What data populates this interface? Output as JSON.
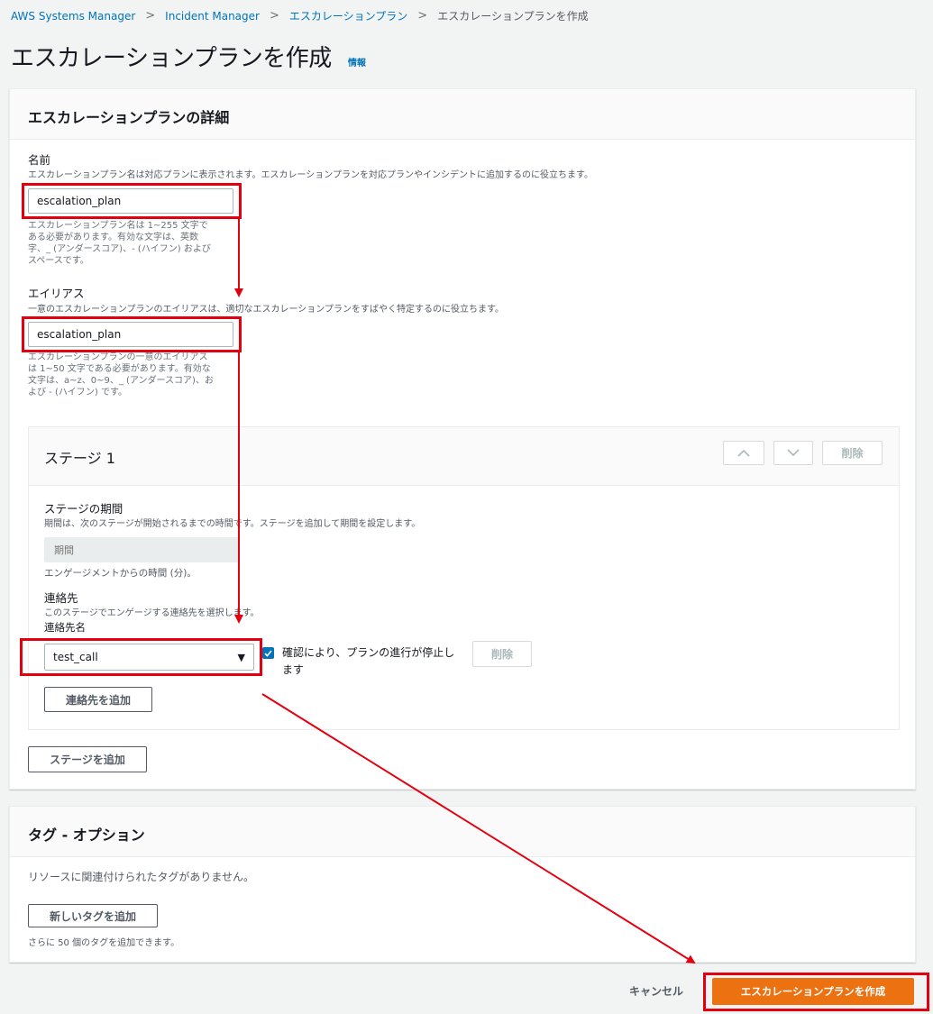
{
  "breadcrumb": {
    "items": [
      "AWS Systems Manager",
      "Incident Manager",
      "エスカレーションプラン"
    ],
    "current": "エスカレーションプランを作成"
  },
  "page": {
    "title": "エスカレーションプランを作成",
    "info": "情報"
  },
  "details": {
    "title": "エスカレーションプランの詳細",
    "name": {
      "label": "名前",
      "desc": "エスカレーションプラン名は対応プランに表示されます。エスカレーションプランを対応プランやインシデントに追加するのに役立ちます。",
      "value": "escalation_plan",
      "constraint": [
        "エスカレーションプラン名は 1~255 文字で",
        "ある必要があります。有効な文字は、英数",
        "字、_ (アンダースコア)、- (ハイフン) および",
        "スペースです。"
      ]
    },
    "alias": {
      "label": "エイリアス",
      "desc": "一意のエスカレーションプランのエイリアスは、適切なエスカレーションプランをすばやく特定するのに役立ちます。",
      "value": "escalation_plan",
      "constraint": [
        "エスカレーションプランの一意のエイリアス",
        "は 1~50 文字である必要があります。有効な",
        "文字は、a~z、0~9、_ (アンダースコア)、お",
        "よび - (ハイフン) です。"
      ]
    }
  },
  "stage": {
    "title": "ステージ 1",
    "up_icon": "chevron-up-icon",
    "down_icon": "chevron-down-icon",
    "delete_label": "削除",
    "duration": {
      "label": "ステージの期間",
      "desc": "期間は、次のステージが開始されるまでの時間です。ステージを追加して期間を設定します。",
      "placeholder": "期間",
      "hint": "エンゲージメントからの時間 (分)。"
    },
    "contacts": {
      "label": "連絡先",
      "desc": "このステージでエンゲージする連絡先を選択します。",
      "name_label": "連絡先名",
      "selected": "test_call",
      "ack_label_line1": "確認により、プランの進行が停止し",
      "ack_label_line2": "ます",
      "ack_checked": true,
      "delete_label": "削除",
      "add_label": "連絡先を追加"
    },
    "add_stage_label": "ステージを追加"
  },
  "tags": {
    "title": "タグ - オプション",
    "empty": "リソースに関連付けられたタグがありません。",
    "add_label": "新しいタグを追加",
    "hint": "さらに 50 個のタグを追加できます。"
  },
  "footer": {
    "cancel": "キャンセル",
    "submit": "エスカレーションプランを作成"
  },
  "colors": {
    "accent": "#ec7211",
    "link": "#0073bb",
    "annotation": "#e3000f"
  }
}
